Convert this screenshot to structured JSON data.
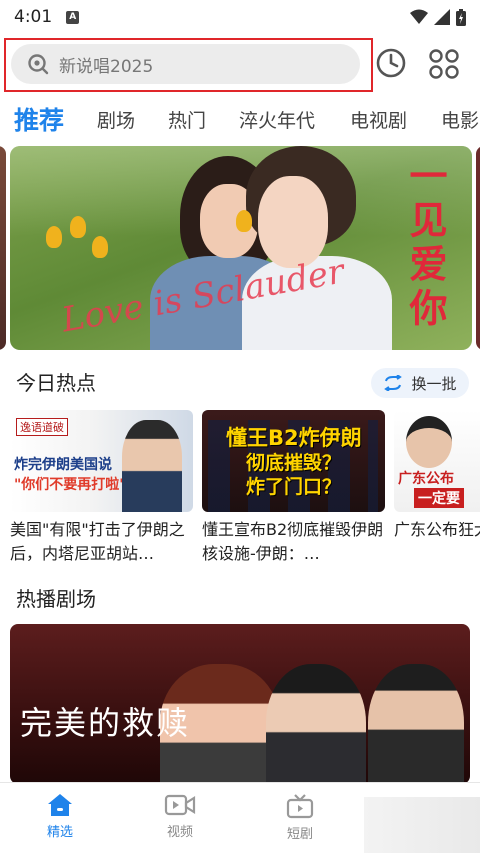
{
  "status_bar": {
    "time": "4:01",
    "notification_badge": "A"
  },
  "search": {
    "placeholder": "新说唱2025"
  },
  "icons": {
    "history": "clock-icon",
    "apps": "four-dots-grid-icon"
  },
  "tabs": [
    {
      "label": "推荐",
      "active": true
    },
    {
      "label": "剧场",
      "active": false
    },
    {
      "label": "热门",
      "active": false
    },
    {
      "label": "淬火年代",
      "active": false
    },
    {
      "label": "电视剧",
      "active": false
    },
    {
      "label": "电影",
      "active": false
    }
  ],
  "banner": {
    "title": "一见爱你",
    "script": "Love is Sclauder"
  },
  "hot_today": {
    "title": "今日热点",
    "refresh_label": "换一批",
    "items": [
      {
        "caption": "美国\"有限\"打击了伊朗之后，内塔尼亚胡站…",
        "thumb_tag": "逸语道破",
        "thumb_line1": "炸完伊朗美国说",
        "thumb_line2": "\"你们不要再打啦\""
      },
      {
        "caption": "懂王宣布B2彻底摧毁伊朗核设施-伊朗：…",
        "thumb_line1": "懂王B2炸伊朗",
        "thumb_line2": "彻底摧毁？",
        "thumb_line3": "炸了门口？"
      },
      {
        "caption": "广东公布狂犬病可防",
        "thumb_line1": "广东公布",
        "thumb_line2": "一定要"
      }
    ]
  },
  "hot_drama": {
    "title": "热播剧场",
    "poster_title": "完美的救赎"
  },
  "bottom_nav": [
    {
      "label": "精选",
      "icon": "home-icon",
      "active": true
    },
    {
      "label": "视频",
      "icon": "video-camera-icon",
      "active": false
    },
    {
      "label": "短剧",
      "icon": "tv-icon",
      "active": false
    }
  ],
  "colors": {
    "accent": "#1f83ea",
    "highlight_box": "#e0262a"
  }
}
